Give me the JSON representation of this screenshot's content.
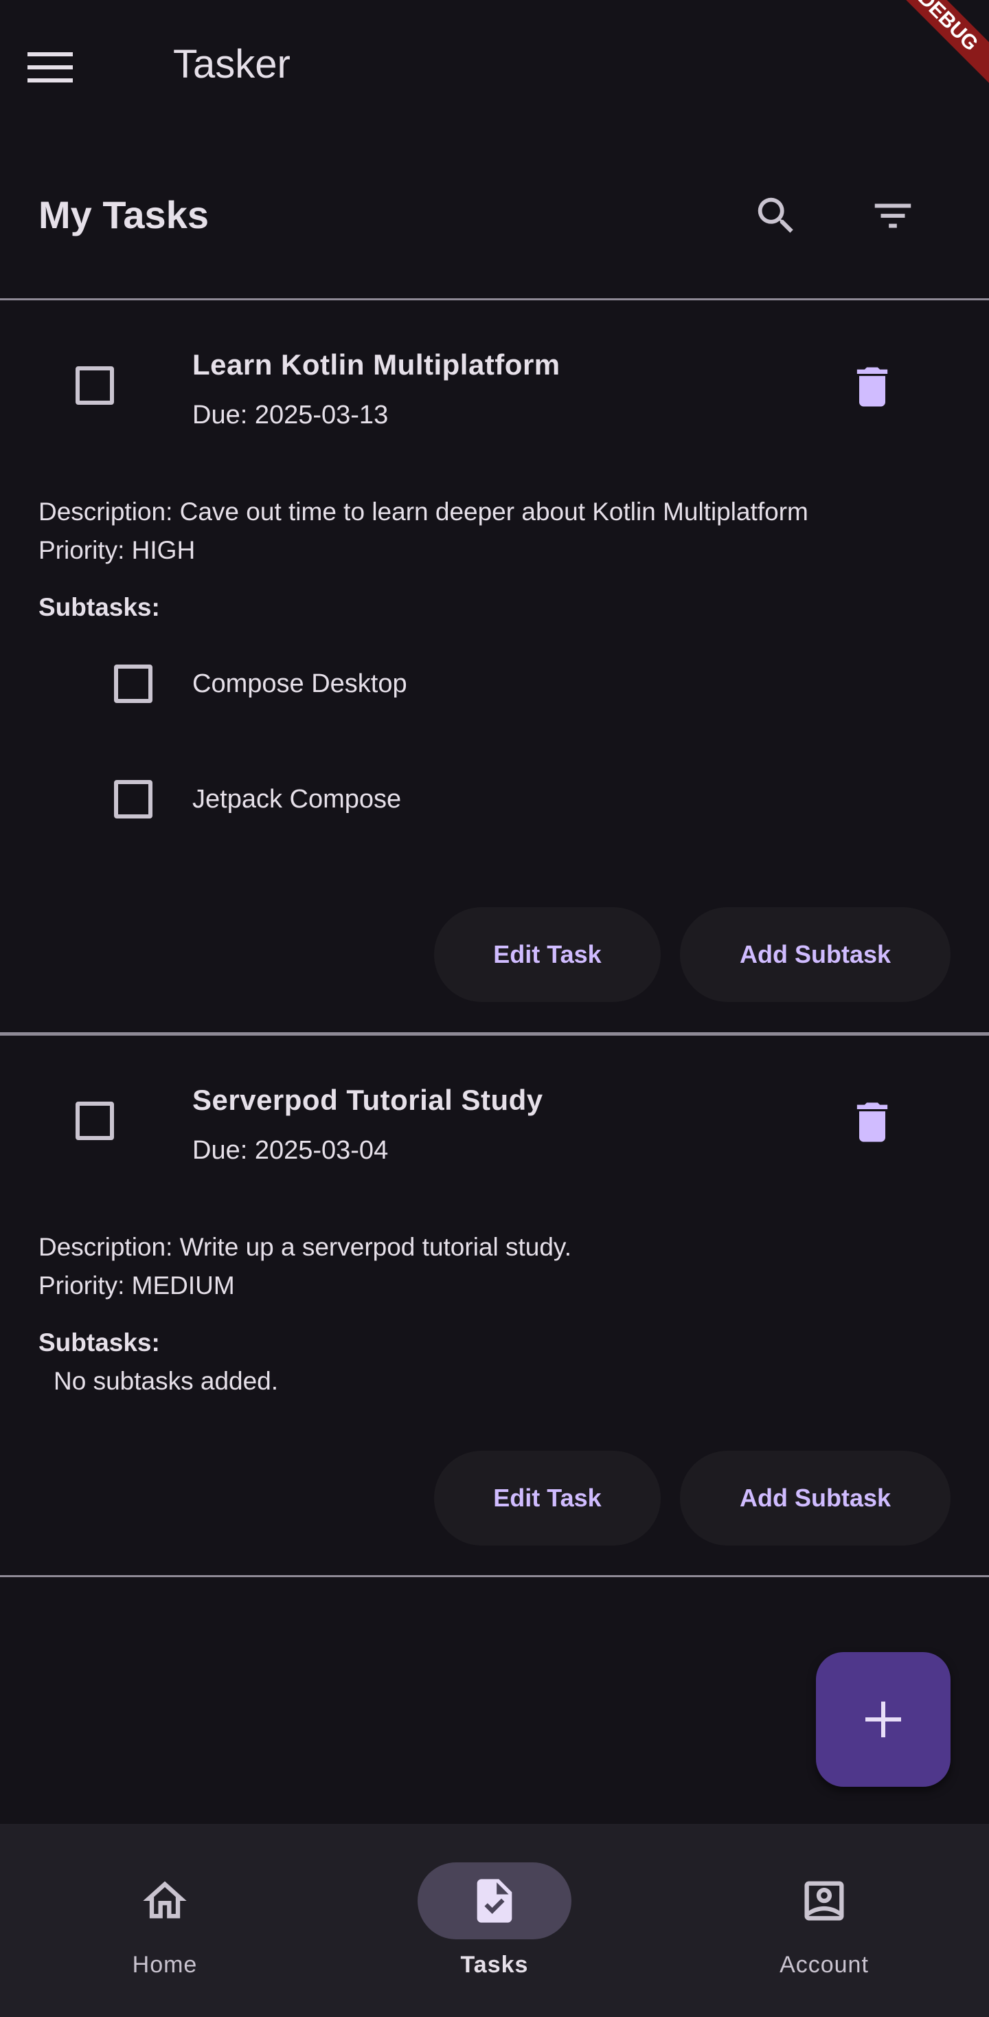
{
  "app": {
    "title": "Tasker",
    "debug_banner": "DEBUG"
  },
  "header": {
    "title": "My Tasks"
  },
  "tasks": [
    {
      "title": "Learn Kotlin Multiplatform",
      "due": "Due: 2025-03-13",
      "description": "Description: Cave out time to learn deeper about Kotlin Multiplatform",
      "priority": "Priority: HIGH",
      "subtasks_label": "Subtasks:",
      "subtasks": [
        {
          "label": "Compose Desktop"
        },
        {
          "label": "Jetpack Compose"
        }
      ],
      "edit_label": "Edit Task",
      "add_sub_label": "Add Subtask"
    },
    {
      "title": "Serverpod Tutorial Study",
      "due": "Due: 2025-03-04",
      "description": "Description: Write up a serverpod tutorial study.",
      "priority": "Priority: MEDIUM",
      "subtasks_label": "Subtasks:",
      "no_subtasks": "No subtasks added.",
      "edit_label": "Edit Task",
      "add_sub_label": "Add Subtask"
    }
  ],
  "nav": {
    "items": [
      {
        "label": "Home",
        "icon": "home-icon"
      },
      {
        "label": "Tasks",
        "icon": "task-icon",
        "active": true
      },
      {
        "label": "Account",
        "icon": "account-icon"
      }
    ]
  },
  "colors": {
    "background": "#141218",
    "accent": "#d0bcff",
    "fab": "#4f378b",
    "nav_background": "#211f26"
  }
}
